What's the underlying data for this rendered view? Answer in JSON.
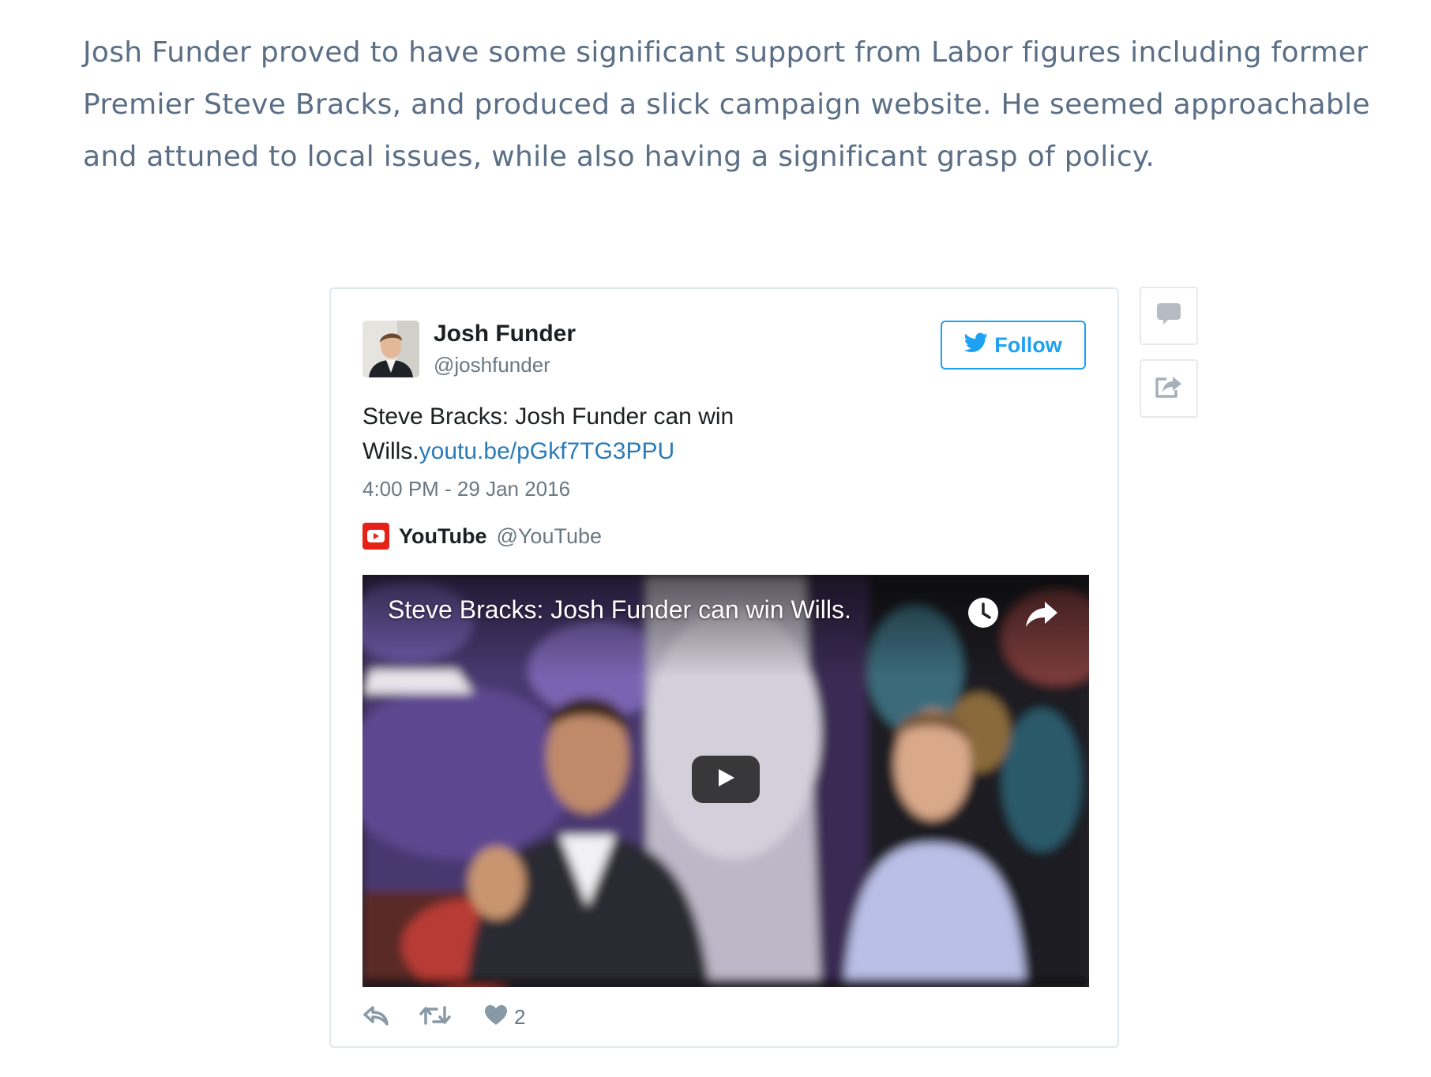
{
  "article": {
    "paragraph": "Josh Funder proved to have some significant support from Labor figures including former Premier Steve Bracks, and produced a slick campaign website. He seemed approachable and attuned to local issues, while also having a significant grasp of policy."
  },
  "tweet": {
    "author_name": "Josh Funder",
    "author_handle": "@joshfunder",
    "follow_label": "Follow",
    "text": "Steve Bracks: Josh Funder can win Wills.",
    "link": "youtu.be/pGkf7TG3PPU",
    "timestamp": "4:00 PM - 29 Jan 2016",
    "via": {
      "name": "YouTube",
      "handle": "@YouTube"
    },
    "video": {
      "title": "Steve Bracks: Josh Funder can win Wills."
    },
    "like_count": "2"
  },
  "icons": {
    "follow": "twitter-bird-icon",
    "via": "youtube-logo-icon",
    "video_watch_later": "clock-icon",
    "video_share": "share-arrow-icon",
    "video_play": "play-icon",
    "reply": "reply-icon",
    "retweet": "retweet-icon",
    "like": "heart-icon",
    "side_comment": "comment-icon",
    "side_share": "share-icon"
  },
  "colors": {
    "article_text": "#5a6f86",
    "twitter_blue": "#1da1f2",
    "link_blue": "#2b7bb9",
    "youtube_red": "#e62117",
    "muted_text": "#697882",
    "card_border": "#e1e8ed"
  }
}
